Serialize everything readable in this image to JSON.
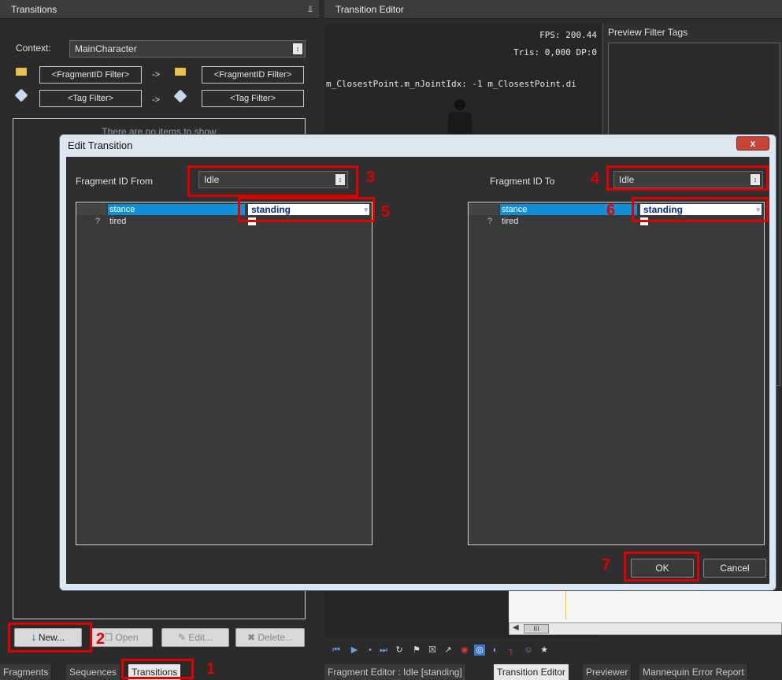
{
  "left_panel": {
    "title": "Transitions",
    "pin_glyph": "ⱏ",
    "context_label": "Context:",
    "context_value": "MainCharacter",
    "from_fragment_filter": "<FragmentID Filter>",
    "to_fragment_filter": "<FragmentID Filter>",
    "from_tag_filter": "<Tag Filter>",
    "to_tag_filter": "<Tag Filter>",
    "arrow": "->",
    "list_empty_text": "There are no items to show",
    "buttons": {
      "new": "New...",
      "open": "Open",
      "edit": "Edit...",
      "delete": "Delete..."
    }
  },
  "right_panel": {
    "title": "Transition Editor",
    "fps": "FPS: 200.44",
    "tris": "Tris: 0,000  DP:0",
    "debug_line": "m_ClosestPoint.m_nJointIdx: -1   m_ClosestPoint.di",
    "preview_filter_tags": "Preview Filter Tags",
    "scroll_label": "III"
  },
  "dialog": {
    "title": "Edit Transition",
    "close": "x",
    "from_label": "Fragment ID From",
    "from_value": "Idle",
    "to_label": "Fragment ID To",
    "to_value": "Idle",
    "from_grid": {
      "rows": [
        {
          "marker": "",
          "name": "stance",
          "value": "standing"
        },
        {
          "marker": "?",
          "name": "tired",
          "value": ""
        }
      ]
    },
    "to_grid": {
      "rows": [
        {
          "marker": "",
          "name": "stance",
          "value": "standing"
        },
        {
          "marker": "?",
          "name": "tired",
          "value": ""
        }
      ]
    },
    "ok": "OK",
    "cancel": "Cancel"
  },
  "annotations": {
    "n1": "1",
    "n2": "2",
    "n3": "3",
    "n4": "4",
    "n5": "5",
    "n6": "6",
    "n7": "7"
  },
  "bottom_tabs_left": [
    "Fragments",
    "Sequences",
    "Transitions"
  ],
  "bottom_tabs_right": [
    "Fragment Editor : Idle [standing]",
    "Transition Editor",
    "Previewer",
    "Mannequin Error Report"
  ],
  "colors": {
    "accent": "#0f8fd8",
    "annotation": "#e00000",
    "dialog_frame": "#dce7f2"
  }
}
